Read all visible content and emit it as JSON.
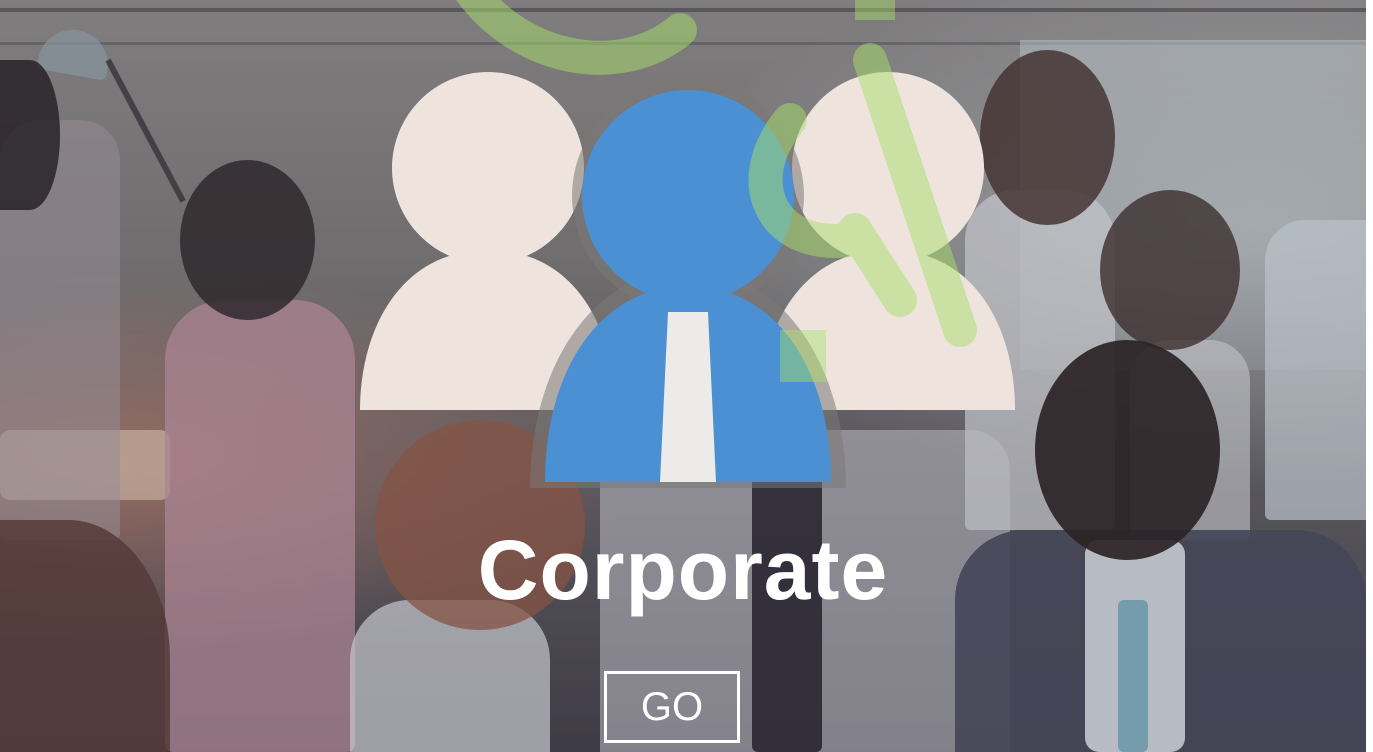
{
  "hero": {
    "headline": "Corporate",
    "cta_label": "GO"
  },
  "icon": {
    "name": "business-team-icon",
    "colors": {
      "member": "#eee4dd",
      "leader": "#4a90d2",
      "tie": "#ecebea"
    }
  },
  "watermark": {
    "name": "logo-watermark",
    "color": "#a8e06a"
  },
  "background": {
    "name": "office-meeting-photo"
  }
}
